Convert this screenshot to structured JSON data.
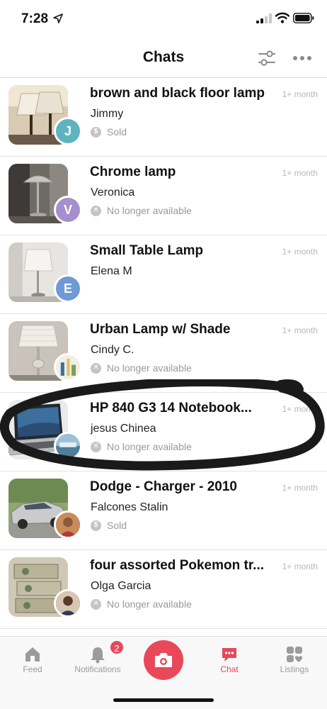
{
  "status_bar": {
    "time": "7:28"
  },
  "header": {
    "title": "Chats"
  },
  "chats": [
    {
      "title": "brown and black floor lamp",
      "name": "Jimmy",
      "status": "Sold",
      "status_type": "sold",
      "time": "1+ month",
      "avatar_letter": "J",
      "avatar_color": "#5fb3bf"
    },
    {
      "title": "Chrome lamp",
      "name": "Veronica",
      "status": "No longer available",
      "status_type": "unavailable",
      "time": "1+ month",
      "avatar_letter": "V",
      "avatar_color": "#a58fcf"
    },
    {
      "title": "Small Table Lamp",
      "name": "Elena M",
      "status": "",
      "status_type": "none",
      "time": "1+ month",
      "avatar_letter": "E",
      "avatar_color": "#6f9ad8"
    },
    {
      "title": "Urban Lamp w/ Shade",
      "name": "Cindy C.",
      "status": "No longer available",
      "status_type": "unavailable",
      "time": "1+ month",
      "avatar_letter": "",
      "avatar_color": "#e8e0c8"
    },
    {
      "title": "HP 840 G3 14 Notebook...",
      "name": "jesus Chinea",
      "status": "No longer available",
      "status_type": "unavailable",
      "time": "1+ month",
      "avatar_letter": "",
      "avatar_color": "#7aa6c4"
    },
    {
      "title": "Dodge - Charger - 2010",
      "name": "Falcones Stalin",
      "status": "Sold",
      "status_type": "sold",
      "time": "1+ month",
      "avatar_letter": "",
      "avatar_color": "#a0522d"
    },
    {
      "title": "four assorted Pokemon tr...",
      "name": "Olga Garcia",
      "status": "No longer available",
      "status_type": "unavailable",
      "time": "1+ month",
      "avatar_letter": "",
      "avatar_color": "#6b4f3a"
    }
  ],
  "tabs": {
    "feed": "Feed",
    "notifications": "Notifications",
    "notifications_badge": "2",
    "chat": "Chat",
    "listings": "Listings"
  },
  "colors": {
    "accent": "#e24a5b",
    "muted": "#9b9b9b"
  }
}
